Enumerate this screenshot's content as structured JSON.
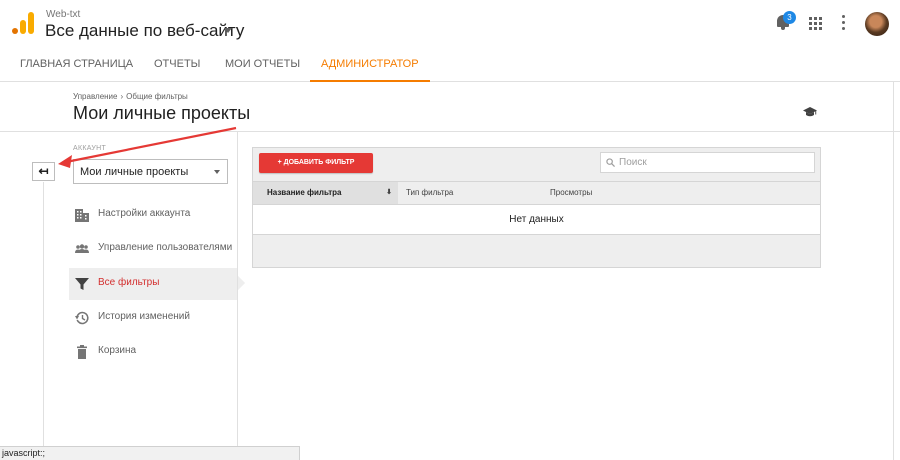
{
  "header": {
    "account_name": "Web-txt",
    "view_selector": "Все данные по веб-сайту",
    "notification_count": "3"
  },
  "nav": {
    "tabs": [
      {
        "label": "ГЛАВНАЯ СТРАНИЦА"
      },
      {
        "label": "ОТЧЕТЫ"
      },
      {
        "label": "МОИ ОТЧЕТЫ"
      },
      {
        "label": "АДМИНИСТРАТОР",
        "active": true
      }
    ]
  },
  "breadcrumb": {
    "items": [
      "Управление",
      "Общие фильтры"
    ],
    "separator": "›"
  },
  "page": {
    "title": "Мои личные проекты"
  },
  "sidebar": {
    "back_glyph": "↤",
    "section_label": "АККАУНТ",
    "account_select": "Мои личные проекты",
    "items": [
      {
        "label": "Настройки аккаунта",
        "icon": "building-icon"
      },
      {
        "label": "Управление пользователями",
        "icon": "users-icon"
      },
      {
        "label": "Все фильтры",
        "icon": "filter-icon",
        "active": true
      },
      {
        "label": "История изменений",
        "icon": "history-icon"
      },
      {
        "label": "Корзина",
        "icon": "trash-icon"
      }
    ]
  },
  "filters": {
    "add_button": "+ ДОБАВИТЬ ФИЛЬТР",
    "search_placeholder": "Поиск",
    "columns": [
      "Название фильтра",
      "Тип фильтра",
      "Просмотры"
    ],
    "sort_glyph": "⬇",
    "empty_message": "Нет данных"
  },
  "status_bar": {
    "text": "javascript:;"
  },
  "colors": {
    "accent_tab": "#f57c00",
    "add_button": "#e53935",
    "active_menu_text": "#d32f2f",
    "annotation_arrow": "#e53935"
  }
}
